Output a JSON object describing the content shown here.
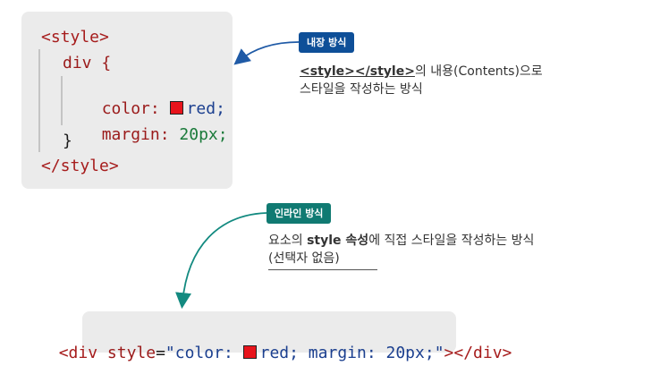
{
  "internal": {
    "badge": "내장 방식",
    "badge_color": "#0e4f98",
    "code": {
      "open_tag": "<style>",
      "selector": "div {",
      "prop1": "color:",
      "val1": "red;",
      "prop2": "margin:",
      "val2": "20px;",
      "close_brace": "}",
      "close_tag": "</style>"
    },
    "desc_tag": "<style></style>",
    "desc_rest1": "의 내용(Contents)으로",
    "desc_line2": "스타일을 작성하는 방식"
  },
  "inline": {
    "badge": "인라인 방식",
    "badge_color": "#107a72",
    "desc_pre": "요소의 ",
    "desc_bold": "style 속성",
    "desc_post": "에 직접 스타일을 작성하는 방식",
    "desc_line2": "(선택자 없음)",
    "code": {
      "open": "<div",
      "attr": "style",
      "eq": "=",
      "val_pre": "\"color: ",
      "val_post": "red; margin: 20px;\"",
      "close": "></div>"
    }
  },
  "swatch_color": "#e8141c"
}
